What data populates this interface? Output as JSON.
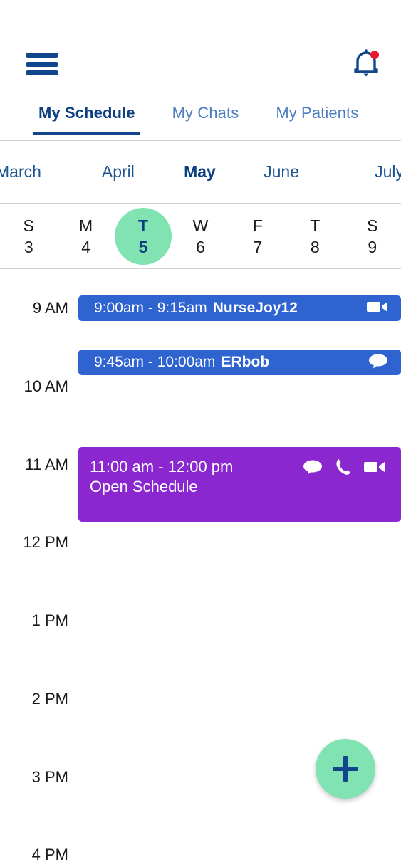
{
  "header": {
    "menu_icon": "hamburger-menu-icon",
    "notification_icon": "bell-icon",
    "has_notification_badge": true,
    "badge_color": "#E8192C",
    "icon_color": "#12468C"
  },
  "tabs": [
    {
      "label": "My Schedule",
      "active": true
    },
    {
      "label": "My Chats",
      "active": false
    },
    {
      "label": "My Patients",
      "active": false
    }
  ],
  "months": [
    {
      "label": "March",
      "active": false
    },
    {
      "label": "April",
      "active": false
    },
    {
      "label": "May",
      "active": true
    },
    {
      "label": "June",
      "active": false
    },
    {
      "label": "July",
      "active": false
    }
  ],
  "days": [
    {
      "dow": "S",
      "num": "3",
      "selected": false
    },
    {
      "dow": "M",
      "num": "4",
      "selected": false
    },
    {
      "dow": "T",
      "num": "5",
      "selected": true
    },
    {
      "dow": "W",
      "num": "6",
      "selected": false
    },
    {
      "dow": "F",
      "num": "7",
      "selected": false
    },
    {
      "dow": "T",
      "num": "8",
      "selected": false
    },
    {
      "dow": "S",
      "num": "9",
      "selected": false
    }
  ],
  "schedule": {
    "time_labels": [
      "9 AM",
      "10 AM",
      "11 AM",
      "12 PM",
      "1 PM",
      "2 PM",
      "3 PM",
      "4 PM"
    ],
    "events": [
      {
        "time": "9:00am - 9:15am",
        "name": "NurseJoy12",
        "title": "",
        "color": "blue",
        "color_hex": "#2E63D0",
        "icons": [
          "video-camera-icon"
        ]
      },
      {
        "time": "9:45am - 10:00am",
        "name": "ERbob",
        "title": "",
        "color": "blue",
        "color_hex": "#2E63D0",
        "icons": [
          "chat-bubble-icon"
        ]
      },
      {
        "time": "11:00 am - 12:00 pm",
        "name": "",
        "title": "Open Schedule",
        "color": "purple",
        "color_hex": "#8B27CE",
        "icons": [
          "chat-bubble-icon",
          "phone-icon",
          "video-camera-icon"
        ]
      }
    ]
  },
  "fab": {
    "icon": "plus-icon",
    "background_color": "#82E3B2",
    "icon_color": "#12468C"
  },
  "theme": {
    "accent_navy": "#12468C",
    "accent_green": "#82E3B2",
    "tab_inactive": "#4B7EBF"
  }
}
